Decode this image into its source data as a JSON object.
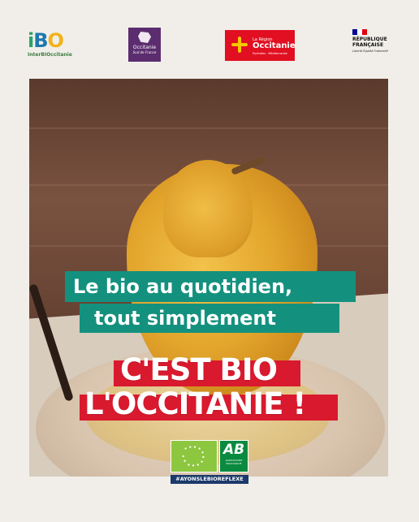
{
  "logos": {
    "interbio": {
      "mark": "iBO",
      "name": "InterBIOccitanie"
    },
    "sud_de_france": {
      "line1": "Occitanie",
      "line2": "Sud de France"
    },
    "region": {
      "small": "La Région",
      "name": "Occitanie",
      "sub": "Pyrénées · Méditerranée"
    },
    "republique": {
      "line1": "RÉPUBLIQUE",
      "line2": "FRANÇAISE",
      "motto": "Liberté Égalité Fraternité"
    }
  },
  "headline": {
    "line1": "Le bio au quotidien,",
    "line2": "tout simplement",
    "big1": "C'EST BIO",
    "big2": "L'OCCITANIE !"
  },
  "labels": {
    "ab_mark": "AB",
    "ab_sub": "AGRICULTURE BIOLOGIQUE",
    "hashtag": "#AYONSLEBIOREFLEXE"
  },
  "colors": {
    "background": "#f1eee9",
    "teal": "#14917e",
    "red": "#d9192e",
    "region_red": "#e10f21",
    "eu_green": "#8dc63f",
    "ab_green": "#0a8a3f",
    "hashtag_navy": "#1b3a6b"
  }
}
